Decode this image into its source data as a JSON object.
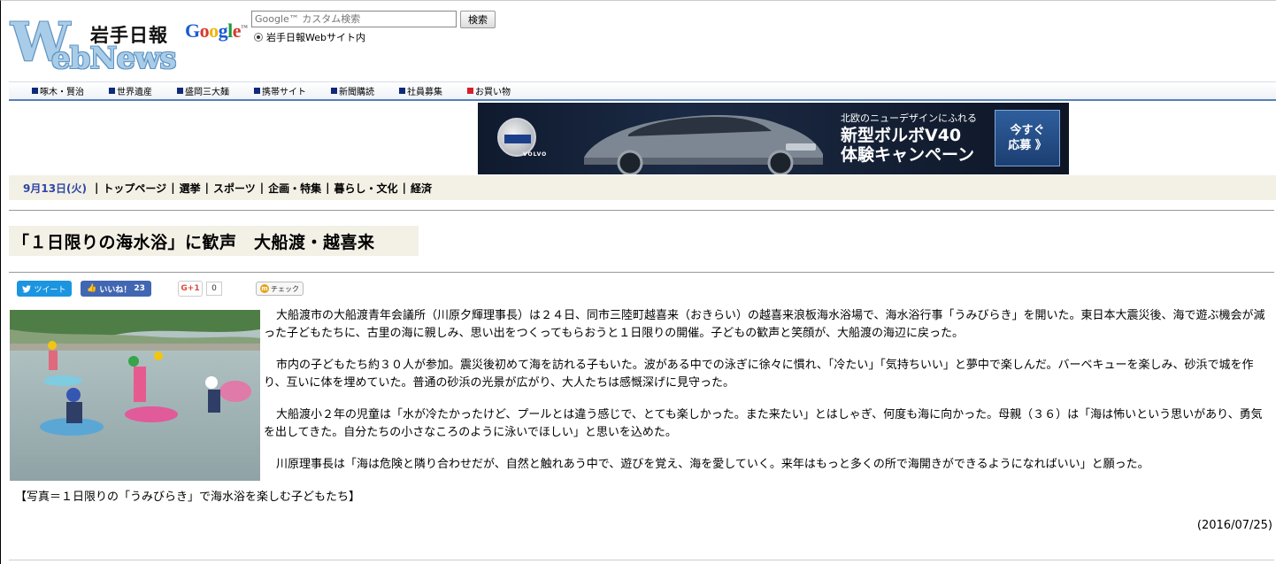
{
  "header": {
    "logo_jp": "岩手日報",
    "logo_w": "W",
    "logo_webnews": "ebNews",
    "google_logo": "Google",
    "search_placeholder": "Google™ カスタム検索",
    "search_button": "検索",
    "search_scope_label": "岩手日報Webサイト内"
  },
  "subnav": {
    "items": [
      {
        "label": "啄木・賢治",
        "color": "#102a7a"
      },
      {
        "label": "世界遺産",
        "color": "#102a7a"
      },
      {
        "label": "盛岡三大麺",
        "color": "#102a7a"
      },
      {
        "label": "携帯サイト",
        "color": "#102a7a"
      },
      {
        "label": "新聞購読",
        "color": "#102a7a"
      },
      {
        "label": "社員募集",
        "color": "#102a7a"
      },
      {
        "label": "お買い物",
        "color": "#d61f2b"
      }
    ]
  },
  "banner": {
    "brand": "VOLVO",
    "subtitle": "北欧のニューデザインにふれる",
    "line1": "新型ボルボV40",
    "line2": "体験キャンペーン",
    "cta_line1": "今すぐ",
    "cta_line2": "応募 》"
  },
  "mainnav": {
    "date": "9月13日(火)",
    "links": [
      "トップページ",
      "選挙",
      "スポーツ",
      "企画・特集",
      "暮らし・文化",
      "経済"
    ]
  },
  "article": {
    "title": "「１日限りの海水浴」に歓声　大船渡・越喜来",
    "paragraphs": [
      "大船渡市の大船渡青年会議所（川原夕輝理事長）は２４日、同市三陸町越喜来（おきらい）の越喜来浪板海水浴場で、海水浴行事「うみびらき」を開いた。東日本大震災後、海で遊ぶ機会が減った子どもたちに、古里の海に親しみ、思い出をつくってもらおうと１日限りの開催。子どもの歓声と笑顔が、大船渡の海辺に戻った。",
      "市内の子どもたち約３０人が参加。震災後初めて海を訪れる子もいた。波がある中での泳ぎに徐々に慣れ、「冷たい」「気持ちいい」と夢中で楽しんだ。バーベキューを楽しみ、砂浜で城を作り、互いに体を埋めていた。普通の砂浜の光景が広がり、大人たちは感慨深げに見守った。",
      "大船渡小２年の児童は「水が冷たかったけど、プールとは違う感じで、とても楽しかった。また来たい」とはしゃぎ、何度も海に向かった。母親（３６）は「海は怖いという思いがあり、勇気を出してきた。自分たちの小さなころのように泳いでほしい」と思いを込めた。",
      "川原理事長は「海は危険と隣り合わせだが、自然と触れあう中で、遊びを覚え、海を愛していく。来年はもっと多くの所で海開きができるようになればいい」と願った。"
    ],
    "caption": "【写真＝１日限りの「うみびらき」で海水浴を楽しむ子どもたち】",
    "date": "(2016/07/25)"
  },
  "social": {
    "tweet": "ツイート",
    "like_label": "いいね！",
    "like_count": "23",
    "gplus": "G+1",
    "gplus_count": "0",
    "check": "チェック"
  }
}
